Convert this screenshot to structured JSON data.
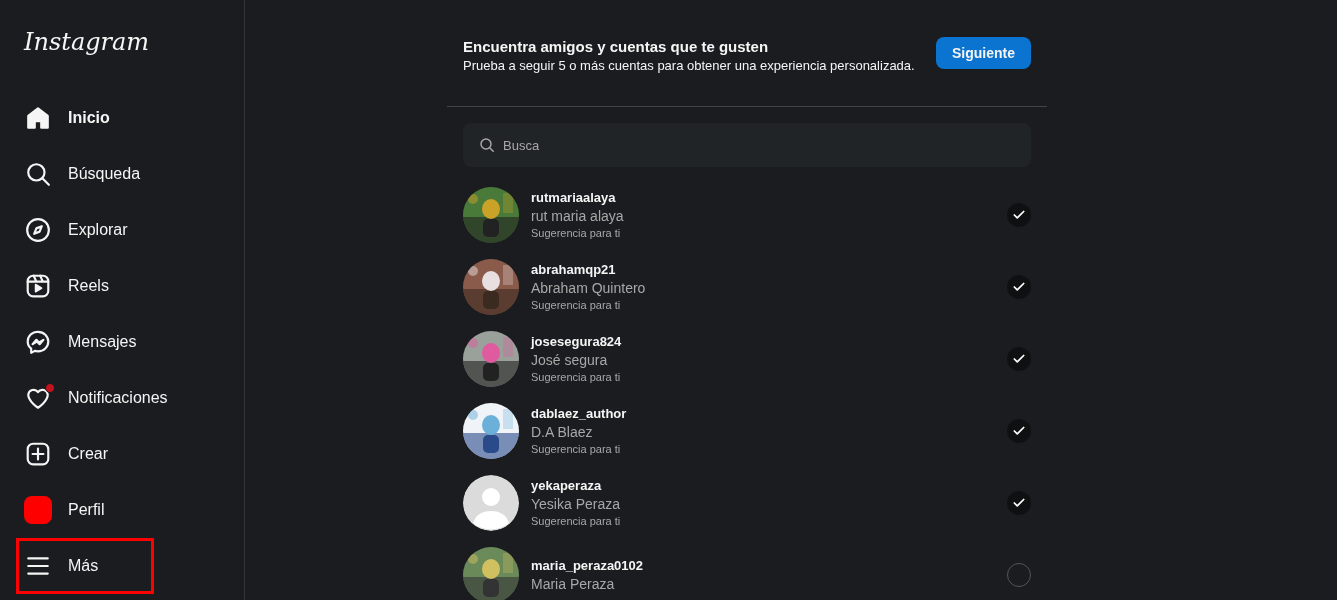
{
  "sidebar": {
    "logo": "Instagram",
    "items": [
      {
        "kind": "home",
        "label": "Inicio",
        "selected": true,
        "dot": false,
        "highlighted": false
      },
      {
        "kind": "search",
        "label": "Búsqueda",
        "selected": false,
        "dot": false,
        "highlighted": false
      },
      {
        "kind": "compass",
        "label": "Explorar",
        "selected": false,
        "dot": false,
        "highlighted": false
      },
      {
        "kind": "reels",
        "label": "Reels",
        "selected": false,
        "dot": false,
        "highlighted": false
      },
      {
        "kind": "messenger",
        "label": "Mensajes",
        "selected": false,
        "dot": false,
        "highlighted": false
      },
      {
        "kind": "heart",
        "label": "Notificaciones",
        "selected": false,
        "dot": true,
        "highlighted": false
      },
      {
        "kind": "plus",
        "label": "Crear",
        "selected": false,
        "dot": false,
        "highlighted": false
      },
      {
        "kind": "profile",
        "label": "Perfil",
        "selected": false,
        "dot": false,
        "highlighted": false
      },
      {
        "kind": "menu",
        "label": "Más",
        "selected": false,
        "dot": false,
        "highlighted": true
      }
    ]
  },
  "header": {
    "title": "Encuentra amigos y cuentas que te gusten",
    "subtitle": "Prueba a seguir 5 o más cuentas para obtener una experiencia personalizada.",
    "button": "Siguiente"
  },
  "search": {
    "placeholder": "Busca"
  },
  "suggestions": [
    {
      "username": "rutmariaalaya",
      "name": "rut maria alaya",
      "note": "Sugerencia para ti",
      "followed": true
    },
    {
      "username": "abrahamqp21",
      "name": "Abraham Quintero",
      "note": "Sugerencia para ti",
      "followed": true
    },
    {
      "username": "josesegura824",
      "name": "José segura",
      "note": "Sugerencia para ti",
      "followed": true
    },
    {
      "username": "dablaez_author",
      "name": "D.A Blaez",
      "note": "Sugerencia para ti",
      "followed": true
    },
    {
      "username": "yekaperaza",
      "name": "Yesika Peraza",
      "note": "Sugerencia para ti",
      "kind": "default",
      "followed": true
    },
    {
      "username": "maria_peraza0102",
      "name": "Maria Peraza",
      "followed": false
    }
  ]
}
